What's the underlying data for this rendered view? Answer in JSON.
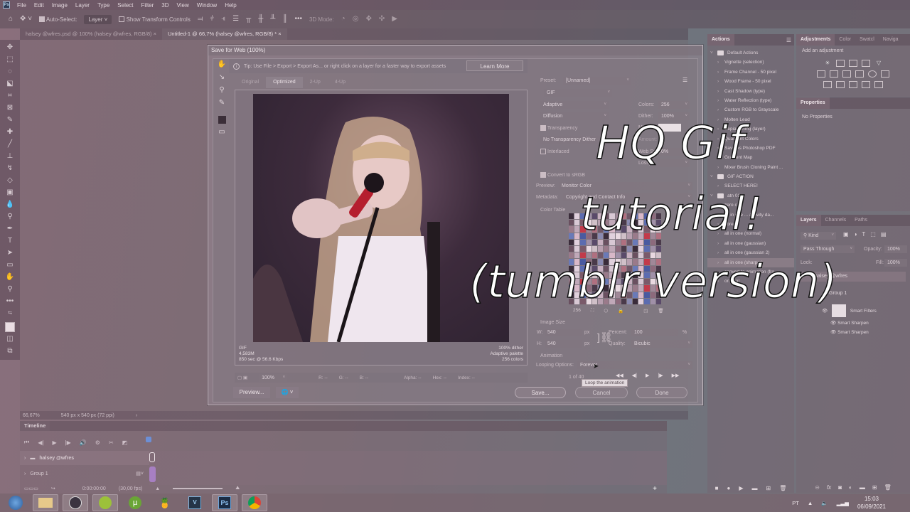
{
  "menubar": {
    "items": [
      "File",
      "Edit",
      "Image",
      "Layer",
      "Type",
      "Select",
      "Filter",
      "3D",
      "View",
      "Window",
      "Help"
    ]
  },
  "optionsbar": {
    "auto_select_label": "Auto-Select:",
    "auto_select_checked": true,
    "auto_select_target": "Layer",
    "show_transform_label": "Show Transform Controls",
    "show_transform_checked": false,
    "mode_3d_label": "3D Mode:"
  },
  "doc_tabs": [
    {
      "label": "halsey @wfres.psd @ 100% (halsey @wfres, RGB/8)",
      "active": false
    },
    {
      "label": "Untitled-1 @ 66,7% (halsey @wfres, RGB/8) *",
      "active": true
    }
  ],
  "statusbar": {
    "zoom": "66,67%",
    "doc_info": "540 px x 540 px (72 ppi)"
  },
  "dialog": {
    "title": "Save for Web (100%)",
    "tip": "Tip: Use File > Export > Export As...  or right click on a layer for a faster way to export assets",
    "learn_more": "Learn More",
    "view_tabs": [
      {
        "label": "Original",
        "active": false
      },
      {
        "label": "Optimized",
        "active": true
      },
      {
        "label": "2-Up",
        "active": false
      },
      {
        "label": "4-Up",
        "active": false
      }
    ],
    "preview_info_left": [
      "GIF",
      "4,583M",
      "850 sec @ 56.6 Kbps"
    ],
    "preview_info_right": [
      "100% dither",
      "Adaptive palette",
      "256 colors"
    ],
    "zoom_value": "100%",
    "readouts": {
      "r": "R: --",
      "g": "G: --",
      "b": "B: --",
      "alpha": "Alpha: --",
      "hex": "Hex: --",
      "index": "Index: --"
    },
    "preview_button": "Preview...",
    "save_button": "Save...",
    "cancel_button": "Cancel",
    "done_button": "Done",
    "settings": {
      "preset_label": "Preset:",
      "preset_value": "[Unnamed]",
      "format": "GIF",
      "reduction": "Adaptive",
      "dither_algo": "Diffusion",
      "colors_label": "Colors:",
      "colors_value": "256",
      "dither_label": "Dither:",
      "dither_value": "100%",
      "matte_label": "Matte:",
      "transparency_label": "Transparency",
      "transparency_checked": true,
      "transparency_dither": "No Transparency Dither",
      "amount_label": "Amount:",
      "interlaced_label": "Interlaced",
      "interlaced_checked": false,
      "websnap_label": "Web Snap:",
      "websnap_value": "0%",
      "lossy_label": "Lossy:",
      "convert_srgb_label": "Convert to sRGB",
      "convert_srgb_checked": true,
      "preview_label": "Preview:",
      "preview_value": "Monitor Color",
      "metadata_label": "Metadata:",
      "metadata_value": "Copyright and Contact Info",
      "color_table_label": "Color Table",
      "color_count": "256",
      "image_size_label": "Image Size",
      "w_label": "W:",
      "w_value": "540",
      "h_label": "H:",
      "h_value": "540",
      "px": "px",
      "percent_label": "Percent:",
      "percent_value": "100",
      "percent_unit": "%",
      "quality_label": "Quality:",
      "quality_value": "Bicubic",
      "animation_label": "Animation",
      "looping_label": "Looping Options:",
      "looping_value": "Forever",
      "frame_counter": "1 of 40",
      "tooltip": "Loop the animation"
    }
  },
  "actions_panel": {
    "tab": "Actions",
    "items": [
      {
        "label": "Default Actions",
        "type": "set"
      },
      {
        "label": "Vignette (selection)",
        "type": "action"
      },
      {
        "label": "Frame Channel - 50 pixel",
        "type": "action"
      },
      {
        "label": "Wood Frame - 50 pixel",
        "type": "action"
      },
      {
        "label": "Cast Shadow (type)",
        "type": "action"
      },
      {
        "label": "Water Reflection (type)",
        "type": "action"
      },
      {
        "label": "Custom RGB to Grayscale",
        "type": "action"
      },
      {
        "label": "Molten Lead",
        "type": "action"
      },
      {
        "label": "Sepia Toning (layer)",
        "type": "action"
      },
      {
        "label": "Quadrant Colors",
        "type": "action"
      },
      {
        "label": "Save As Photoshop PDF",
        "type": "action"
      },
      {
        "label": "Gradient Map",
        "type": "action"
      },
      {
        "label": "Mixer Brush Cloning Paint ...",
        "type": "action"
      },
      {
        "label": "GIF ACTION",
        "type": "set"
      },
      {
        "label": "SELECT HERE!",
        "type": "action"
      },
      {
        "label": "atn 01",
        "type": "set"
      },
      {
        "label": "zero c...",
        "type": "action"
      },
      {
        "label": "all in one ... activity da...",
        "type": "action"
      },
      {
        "label": "korean",
        "type": "action"
      },
      {
        "label": "all in one (normal)",
        "type": "action"
      },
      {
        "label": "all in one (gaussian)",
        "type": "action"
      },
      {
        "label": "all in one (gaussian 2)",
        "type": "action"
      },
      {
        "label": "all in one (sharper)",
        "type": "action",
        "highlight": true
      },
      {
        "label": "convert to animation (fra...",
        "type": "action"
      },
      {
        "label": "original",
        "type": "action"
      }
    ]
  },
  "adjustments_panel": {
    "tabs": [
      {
        "label": "Adjustments",
        "active": true
      },
      {
        "label": "Color",
        "active": false
      },
      {
        "label": "Swatcl",
        "active": false
      },
      {
        "label": "Naviga",
        "active": false
      }
    ],
    "hint": "Add an adjustment"
  },
  "properties_panel": {
    "tab": "Properties",
    "empty": "No Properties"
  },
  "layers_panel": {
    "tabs": [
      {
        "label": "Layers",
        "active": true
      },
      {
        "label": "Channels",
        "active": false
      },
      {
        "label": "Paths",
        "active": false
      }
    ],
    "filter_kind": "Kind",
    "blend_mode": "Pass Through",
    "opacity_label": "Opacity:",
    "opacity_value": "100%",
    "lock_label": "Lock:",
    "fill_label": "Fill:",
    "fill_value": "100%",
    "layers": [
      {
        "name": "halsey @wfres",
        "type": "group"
      },
      {
        "name": "Group 1",
        "type": "layer"
      },
      {
        "name": "Smart Filters",
        "type": "filters"
      },
      {
        "name": "Smart Sharpen",
        "type": "filter"
      },
      {
        "name": "Smart Sharpen",
        "type": "filter"
      }
    ]
  },
  "timeline": {
    "tab": "Timeline",
    "tracks": [
      {
        "name": "halsey @wfres"
      },
      {
        "name": "Group 1"
      }
    ],
    "timecode": "0:00:00:00",
    "fps": "(30,00 fps)"
  },
  "overlay_title": [
    "HQ Gif",
    "tutorial!",
    "(tumblr version)"
  ],
  "taskbar": {
    "apps": [
      "start-orb",
      "file-explorer",
      "obs",
      "app-green",
      "utorrent",
      "vlc-like",
      "vegas",
      "photoshop",
      "chrome"
    ],
    "lang": "PT",
    "time": "15:03",
    "date": "06/09/2021"
  },
  "colors": {
    "accent_purple": "#a77fc2",
    "playhead_blue": "#6c8fd6"
  }
}
